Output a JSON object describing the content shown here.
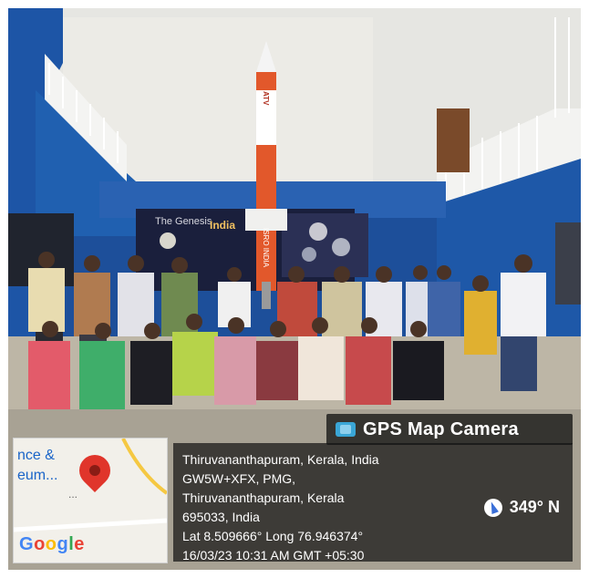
{
  "badge": {
    "title": "GPS Map Camera",
    "icon": "camera-icon",
    "icon_color": "#3aa6d6"
  },
  "location": {
    "line1": "Thiruvananthapuram, Kerala, India",
    "line2": "GW5W+XFX, PMG,",
    "line3": "Thiruvananthapuram, Kerala",
    "line4": "695033, India",
    "line5": "Lat 8.509666° Long 76.946374°",
    "line6": "16/03/23 10:31 AM GMT +05:30"
  },
  "compass": {
    "heading": "349° N",
    "icon": "compass-icon"
  },
  "map": {
    "label1": "nce &",
    "label2": "eum...",
    "label3": "...",
    "logo": [
      "G",
      "o",
      "o",
      "g",
      "l",
      "e"
    ],
    "pin_color": "#e0352b"
  },
  "scene": {
    "rocket_text_top": "ATV",
    "rocket_text_body": "ISRO INDIA",
    "exhibit_title": "The Genesis",
    "exhibit_india": "India"
  }
}
